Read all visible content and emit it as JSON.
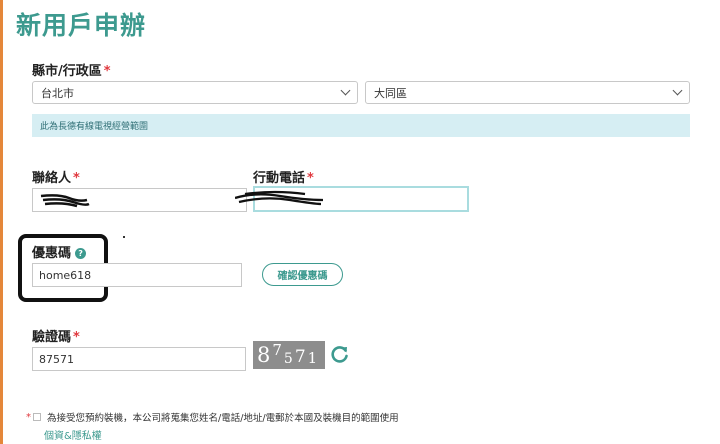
{
  "form": {
    "title": "新用戶申辦",
    "region": {
      "label": "縣市/行政區",
      "required_mark": "*",
      "city_value": "台北市",
      "district_value": "大同區",
      "notice": "此為長德有線電視經營範圍"
    },
    "contact": {
      "label": "聯絡人",
      "required_mark": "*"
    },
    "mobile": {
      "label": "行動電話",
      "required_mark": "*"
    },
    "coupon": {
      "label": "優惠碼",
      "help_icon": "question-circle-icon",
      "value": "home618",
      "confirm_label": "確認優惠碼"
    },
    "captcha": {
      "label": "驗證碼",
      "required_mark": "*",
      "value": "87571",
      "image_text": [
        "8",
        "7",
        "5",
        "7",
        "1"
      ],
      "refresh_icon": "refresh-icon"
    },
    "consent": {
      "required_mark": "*",
      "text": "為接受您預約裝機，本公司將蒐集您姓名/電話/地址/電郵於本國及裝機目的範圍使用",
      "privacy_link": "個資&隱私權"
    }
  },
  "colors": {
    "brand": "#3d9a8f",
    "accent_bar": "#e4873a",
    "required": "#e0383e",
    "notice_bg": "#d6eef3"
  }
}
